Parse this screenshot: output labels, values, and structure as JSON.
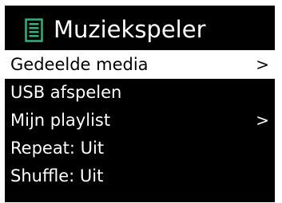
{
  "header": {
    "title": "Muziekspeler",
    "icon": "music-player-icon",
    "icon_color": "#2fb37e"
  },
  "menu": {
    "items": [
      {
        "label": "Gedeelde media",
        "arrow": ">",
        "selected": true
      },
      {
        "label": "USB afspelen",
        "arrow": "",
        "selected": false
      },
      {
        "label": "Mijn playlist",
        "arrow": ">",
        "selected": false
      },
      {
        "label": "Repeat: Uit",
        "arrow": "",
        "selected": false
      },
      {
        "label": "Shuffle: Uit",
        "arrow": "",
        "selected": false
      }
    ]
  },
  "colors": {
    "background": "#000000",
    "text": "#ffffff",
    "selection": "#ffffff",
    "selection_text": "#000000"
  }
}
